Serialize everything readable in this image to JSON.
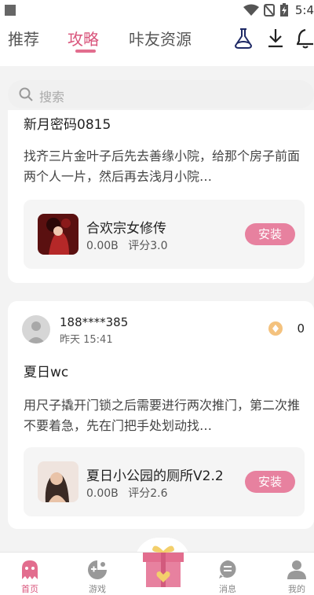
{
  "status_bar": {
    "time": "5:4"
  },
  "header": {
    "tabs": [
      {
        "label": "推荐"
      },
      {
        "label": "攻略"
      },
      {
        "label": "咔友资源"
      }
    ],
    "accent_color": "#d9557c"
  },
  "search": {
    "placeholder": "搜索"
  },
  "posts": [
    {
      "title": "新月密码0815",
      "body": "找齐三片金叶子后先去善缘小院，给那个房子前面两个人一片，然后再去浅月小院…",
      "app": {
        "name": "合欢宗女修传",
        "size": "0.00B",
        "rating": "评分3.0",
        "install_label": "安装"
      }
    },
    {
      "user": {
        "name": "188****385",
        "time": "昨天 15:41"
      },
      "coins": "0",
      "title": "夏日wc",
      "body": "用尺子撬开门锁之后需要进行两次推门，第二次推不要着急，先在门把手处划动找…",
      "app": {
        "name": "夏日小公园的厕所V2.2",
        "size": "0.00B",
        "rating": "评分2.6",
        "install_label": "安装"
      }
    }
  ],
  "bottom_nav": [
    {
      "label": "首页",
      "icon": "ghost-icon"
    },
    {
      "label": "游戏",
      "icon": "gamepad-icon"
    },
    {
      "label": "",
      "icon": "gift-icon"
    },
    {
      "label": "消息",
      "icon": "message-icon"
    },
    {
      "label": "我的",
      "icon": "person-icon"
    }
  ]
}
